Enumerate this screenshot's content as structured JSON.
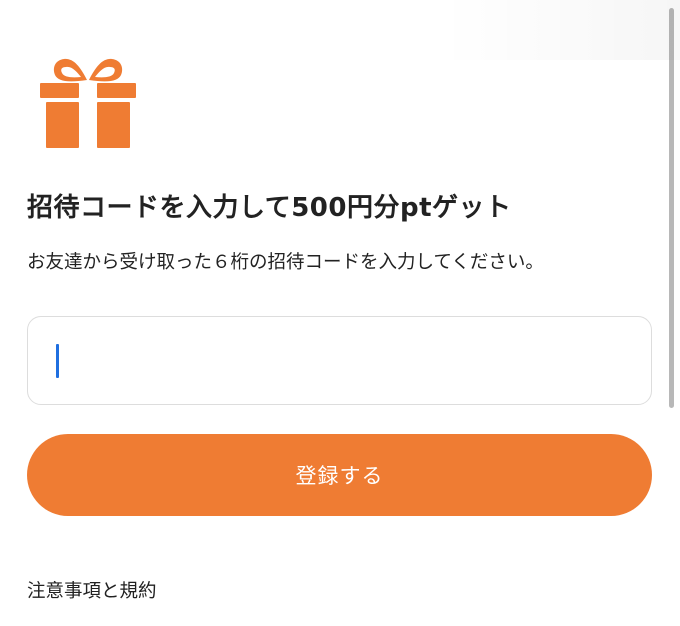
{
  "header": {
    "icon": "gift-icon",
    "icon_color": "#ef7c33"
  },
  "invite": {
    "title": "招待コードを入力して500円分ptゲット",
    "description": "お友達から受け取った６桁の招待コードを入力してください。",
    "code_value": "",
    "code_placeholder": ""
  },
  "actions": {
    "submit_label": "登録する",
    "submit_color": "#ef7c33"
  },
  "footer": {
    "terms_label": "注意事項と規約"
  }
}
